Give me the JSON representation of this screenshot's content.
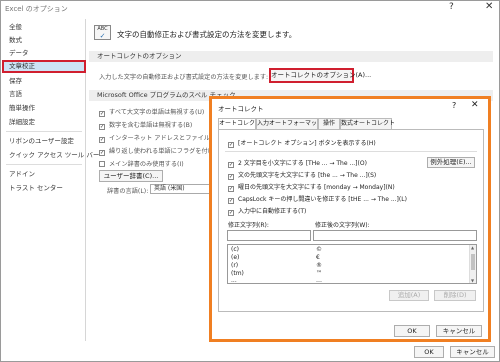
{
  "window": {
    "title": "Excel のオプション",
    "help": "?",
    "close": "✕"
  },
  "sidebar": {
    "items": [
      "全般",
      "数式",
      "データ",
      "文章校正",
      "保存",
      "言語",
      "簡単操作",
      "詳細設定",
      "リボンのユーザー設定",
      "クイック アクセス ツール バー",
      "アドイン",
      "トラスト センター"
    ],
    "active": "文章校正"
  },
  "main": {
    "heading": "文字の自動修正および書式設定の方法を変更します。",
    "abc_icon_text": "ABC",
    "autocorrect_section": "オートコレクトのオプション",
    "autocorrect_desc": "入力した文字の自動修正および書式設定の方法を変更します:",
    "autocorrect_button": "オートコレクトのオプション(A)...",
    "spell_section": "Microsoft Office プログラムのスペル チェック",
    "spell_options": [
      "すべて大文字の単語は無視する(U)",
      "数字を含む単語は無視する(B)",
      "インターネット アドレスとファイル パスは無",
      "繰り返し使われる単語にフラグを付ける(",
      "メイン辞書のみ使用する(I)"
    ],
    "user_dict_button": "ユーザー辞書(C)...",
    "dict_lang_label": "辞書の言語(L):",
    "dict_lang_value": "英語 (米国)"
  },
  "footer": {
    "ok": "OK",
    "cancel": "キャンセル"
  },
  "dialog": {
    "title": "オートコレクト",
    "help": "?",
    "close": "✕",
    "tabs": [
      "オートコレクト",
      "入力オートフォーマット",
      "操作",
      "数式オートコレクト"
    ],
    "show_buttons_option": "[オートコレクト オプション] ボタンを表示する(H)",
    "options": [
      "2 文字目を小文字にする [THe ... → The ...](O)",
      "文の先頭文字を大文字にする [the ... → The ...](S)",
      "曜日の先頭文字を大文字にする [monday → Monday](N)",
      "CapsLock キーの押し間違いを修正する [tHE ... → The ...](L)",
      "入力中に自動修正する(T)"
    ],
    "exceptions_button": "例外処理(E)...",
    "replace_label": "修正文字列(R):",
    "with_label": "修正後の文字列(W):",
    "replace_value": "",
    "with_value": "",
    "list": [
      {
        "from": "(c)",
        "to": "©"
      },
      {
        "from": "(e)",
        "to": "€"
      },
      {
        "from": "(r)",
        "to": "®"
      },
      {
        "from": "(tm)",
        "to": "™"
      },
      {
        "from": "...",
        "to": "…"
      }
    ],
    "add_button": "追加(A)",
    "delete_button": "削除(D)",
    "ok": "OK",
    "cancel": "キャンセル"
  },
  "colors": {
    "highlight_red": "#d01f2f",
    "dialog_orange": "#f07f22",
    "active_blue": "#cde3f5"
  }
}
